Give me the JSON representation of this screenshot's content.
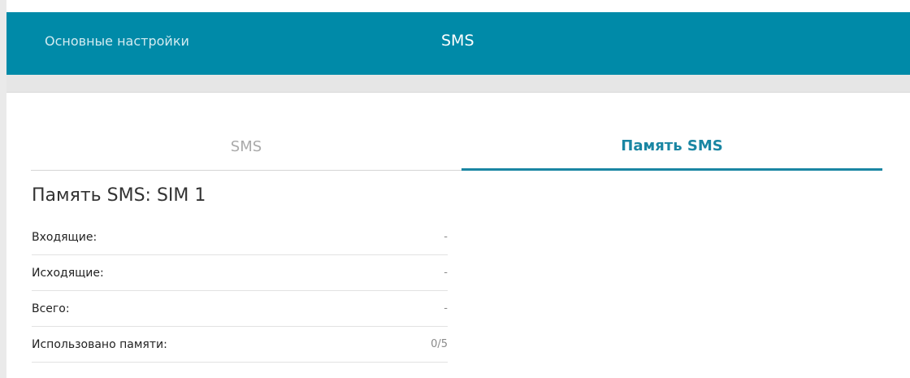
{
  "header": {
    "breadcrumb": "Основные настройки",
    "title": "SMS"
  },
  "tabs": [
    {
      "label": "SMS",
      "active": false
    },
    {
      "label": "Память SMS",
      "active": true
    }
  ],
  "section": {
    "title": "Память SMS: SIM 1"
  },
  "rows": [
    {
      "label": "Входящие:",
      "value": "-"
    },
    {
      "label": "Исходящие:",
      "value": "-"
    },
    {
      "label": "Всего:",
      "value": "-"
    },
    {
      "label": "Использовано памяти:",
      "value": "0/5"
    }
  ],
  "colors": {
    "header_bg": "#008aa8",
    "accent": "#1a86a3"
  }
}
